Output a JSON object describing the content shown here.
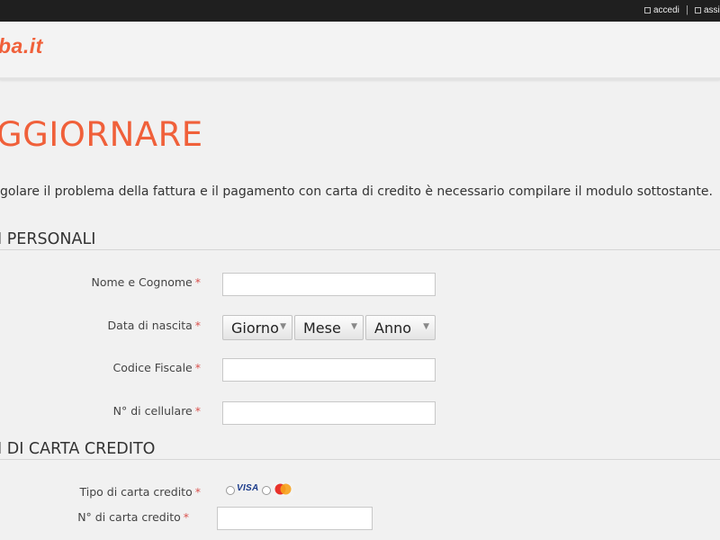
{
  "topbar": {
    "login_label": "accedi",
    "help_label": "assis"
  },
  "header": {
    "logo_text": "ba.it"
  },
  "page": {
    "title": "GGIORNARE",
    "intro": "golare il problema della fattura e il pagamento con carta di credito è necessario compilare il modulo sottostante."
  },
  "sections": {
    "personal": {
      "title": "I PERSONALI",
      "name_label": "Nome e Cognome",
      "dob_label": "Data di nascita",
      "day_select": "Giorno",
      "month_select": "Mese",
      "year_select": "Anno",
      "tax_code_label": "Codice Fiscale",
      "mobile_label": "N° di cellulare"
    },
    "card": {
      "title": "I DI CARTA CREDITO",
      "card_type_label": "Tipo di carta credito",
      "visa_label": "VISA",
      "card_number_label": "N° di carta credito"
    }
  },
  "required_mark": "*",
  "colors": {
    "accent": "#f0603a",
    "topbar": "#1f1f1f",
    "background": "#f1f1f1",
    "required": "#d9534f"
  }
}
